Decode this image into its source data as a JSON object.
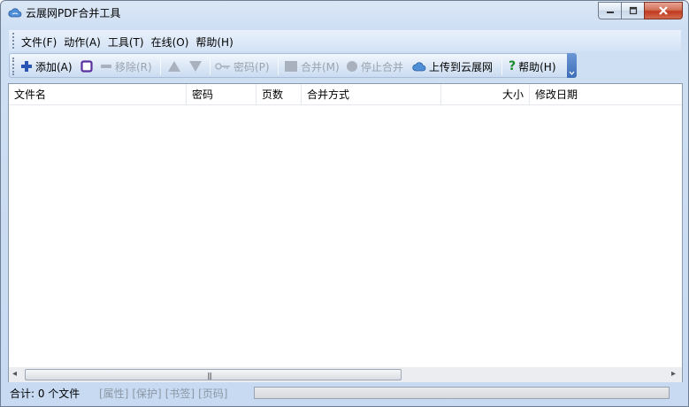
{
  "window": {
    "title": "云展网PDF合并工具",
    "accent": "#3e6db8",
    "close_color": "#c1391e"
  },
  "menubar": {
    "items": [
      "文件(F)",
      "动作(A)",
      "工具(T)",
      "在线(O)",
      "帮助(H)"
    ]
  },
  "toolbar": {
    "add": "添加(A)",
    "remove": "移除(R)",
    "password": "密码(P)",
    "merge": "合并(M)",
    "stop": "停止合并",
    "upload": "上传到云展网",
    "help": "帮助(H)",
    "icons": [
      "plus-icon",
      "checkbox-icon",
      "minus-icon",
      "up-arrow-icon",
      "down-arrow-icon",
      "key-icon",
      "merge-icon",
      "stop-icon",
      "cloud-icon",
      "help-icon"
    ]
  },
  "table": {
    "columns": [
      "文件名",
      "密码",
      "页数",
      "合并方式",
      "大小",
      "修改日期"
    ],
    "rows": []
  },
  "statusbar": {
    "count": "合计: 0 个文件",
    "flags": [
      "[属性]",
      "[保护]",
      "[书签]",
      "[页码]"
    ]
  }
}
